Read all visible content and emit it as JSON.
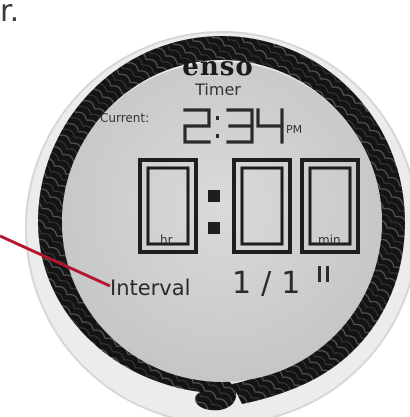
{
  "top_fragment": "r.",
  "device": {
    "brand": "enso",
    "mode": "Timer",
    "current_label": "Current:",
    "current_time": "2:34",
    "current_ampm": "PM",
    "timer": {
      "hours_digit": "0",
      "minutes_digits": "00",
      "separator": ":",
      "hr_label": "hr",
      "min_label": "min"
    },
    "interval_label": "Interval",
    "interval_count": "1/1",
    "status_icon": "pause-icon"
  },
  "colors": {
    "ring": "#151515",
    "ring_highlight": "#6a6a6a",
    "face": "#cfcfcf",
    "bezel": "#e8e8e8",
    "digits": "#2a2a2a",
    "pointer_line": "#b3162c"
  }
}
